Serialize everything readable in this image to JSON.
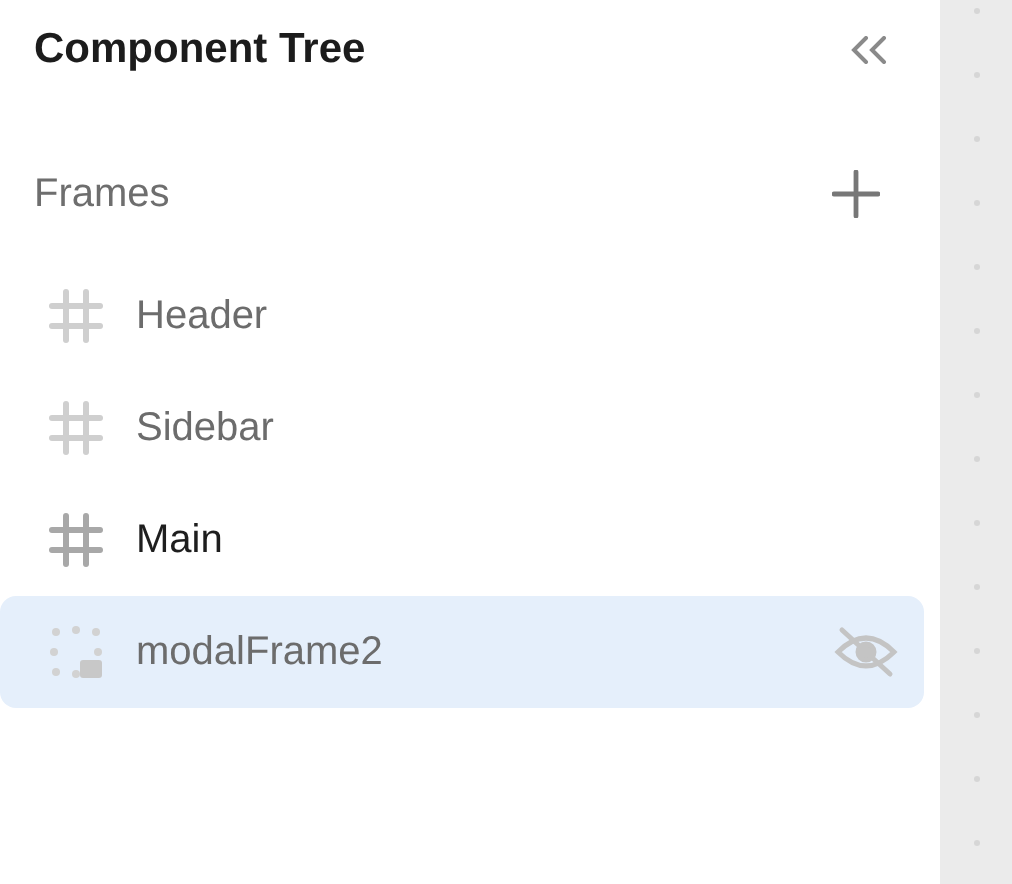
{
  "panel": {
    "title": "Component Tree"
  },
  "section": {
    "label": "Frames"
  },
  "frames": [
    {
      "name": "Header",
      "kind": "frame",
      "dimmed": true,
      "selected": false,
      "hidden": false
    },
    {
      "name": "Sidebar",
      "kind": "frame",
      "dimmed": true,
      "selected": false,
      "hidden": false
    },
    {
      "name": "Main",
      "kind": "frame",
      "dimmed": false,
      "selected": false,
      "hidden": false
    },
    {
      "name": "modalFrame2",
      "kind": "modal",
      "dimmed": true,
      "selected": true,
      "hidden": true
    }
  ]
}
